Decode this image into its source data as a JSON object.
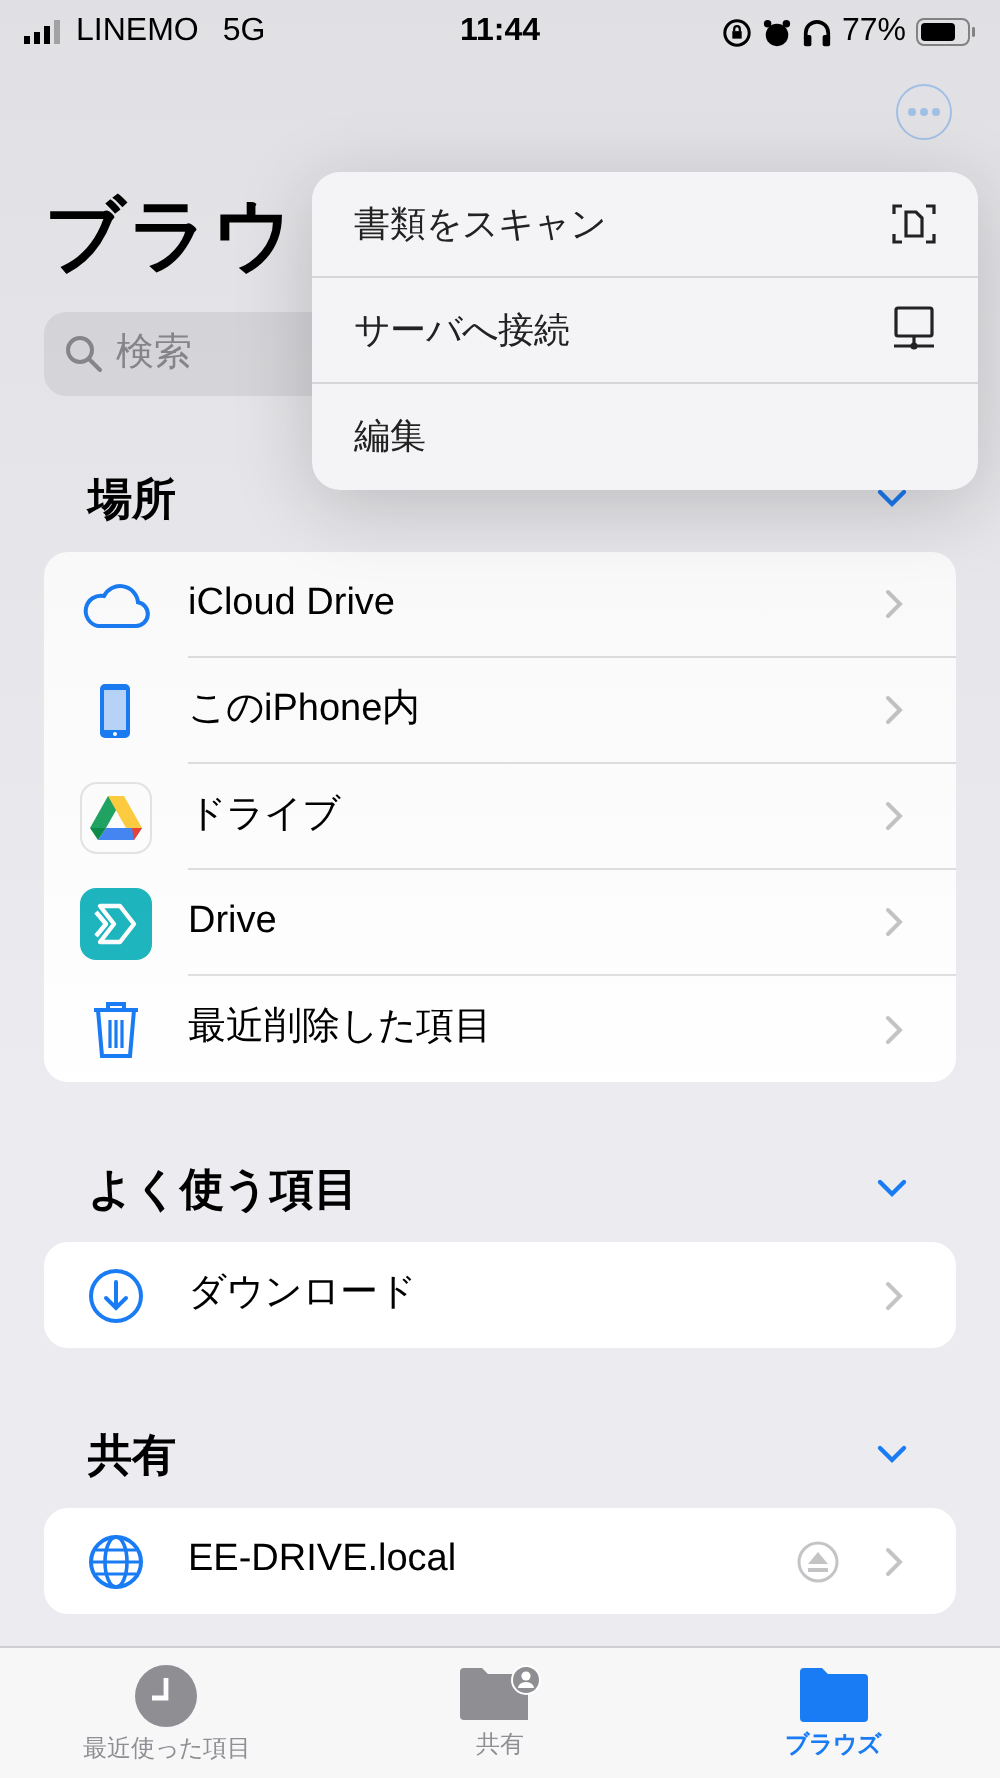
{
  "status_bar": {
    "carrier": "LINEMO",
    "network": "5G",
    "time": "11:44",
    "battery": "77%"
  },
  "title": "ブラウ",
  "search": {
    "placeholder": "検索"
  },
  "menu": [
    {
      "label": "書類をスキャン",
      "kind": "scan"
    },
    {
      "label": "サーバへ接続",
      "kind": "server"
    },
    {
      "label": "編集",
      "kind": "plain"
    }
  ],
  "sections": [
    {
      "title": "場所",
      "expanded": true,
      "items": [
        {
          "label": "iCloud Drive",
          "kind": "cloud"
        },
        {
          "label": "このiPhone内",
          "kind": "phone"
        },
        {
          "label": "ドライブ",
          "kind": "gdrive"
        },
        {
          "label": "Drive",
          "kind": "appdrive"
        },
        {
          "label": "最近削除した項目",
          "kind": "trash"
        }
      ]
    },
    {
      "title": "よく使う項目",
      "expanded": true,
      "items": [
        {
          "label": "ダウンロード",
          "kind": "download"
        }
      ]
    },
    {
      "title": "共有",
      "expanded": true,
      "items": [
        {
          "label": "EE-DRIVE.local",
          "kind": "network"
        }
      ]
    }
  ],
  "tabs": [
    {
      "label": "最近使った項目",
      "kind": "recent",
      "selected": false
    },
    {
      "label": "共有",
      "kind": "shared",
      "selected": false
    },
    {
      "label": "ブラウズ",
      "kind": "browse",
      "selected": true
    }
  ]
}
